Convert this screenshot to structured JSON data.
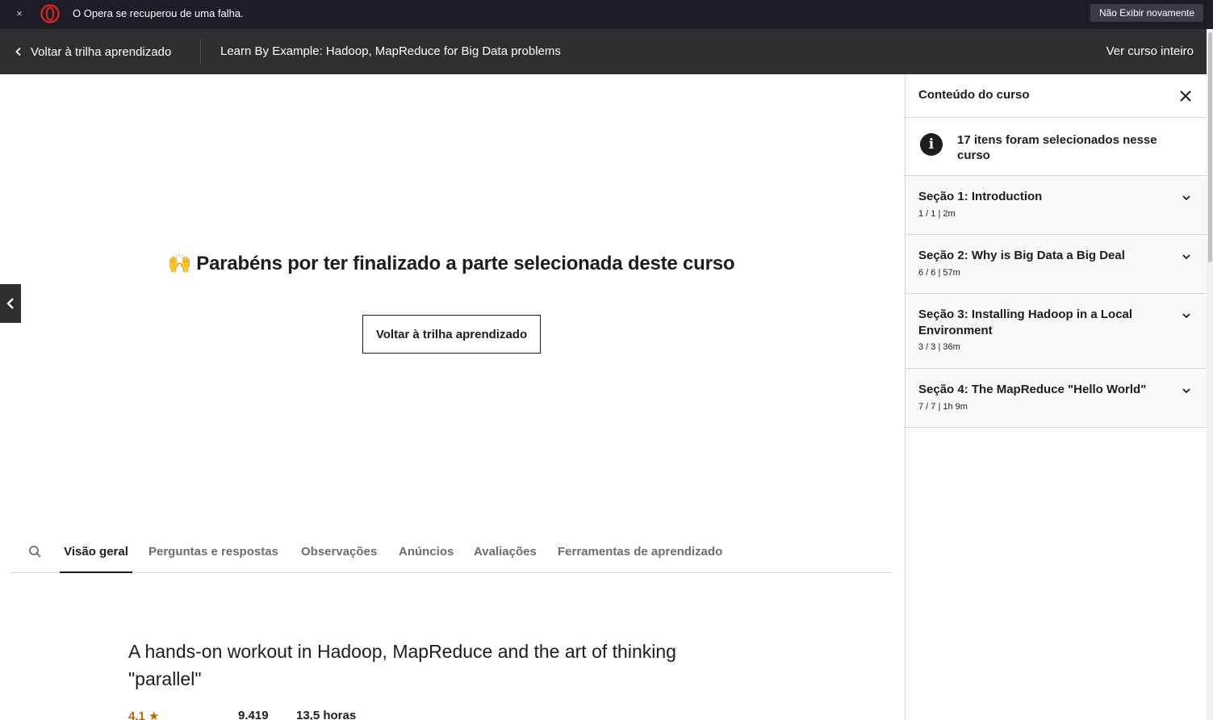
{
  "opera_bar": {
    "message": "O Opera se recuperou de uma falha.",
    "dismiss_label": "Não Exibir novamente",
    "close_glyph": "×"
  },
  "header": {
    "back_label": "Voltar à trilha aprendizado",
    "course_title": "Learn By Example: Hadoop, MapReduce for Big Data problems",
    "full_course_label": "Ver curso inteiro"
  },
  "main": {
    "congrats_emoji": "🙌",
    "congrats_text": "Parabéns por ter finalizado a parte selecionada deste curso",
    "return_button": "Voltar à trilha aprendizado"
  },
  "tabs": [
    {
      "label": "Visão geral",
      "active": true
    },
    {
      "label": "Perguntas e respostas",
      "active": false
    },
    {
      "label": "Observações",
      "active": false
    },
    {
      "label": "Anúncios",
      "active": false
    },
    {
      "label": "Avaliações",
      "active": false
    },
    {
      "label": "Ferramentas de aprendizado",
      "active": false
    }
  ],
  "overview": {
    "headline": "A hands-on workout in Hadoop, MapReduce and the art of thinking \"parallel\"",
    "rating": "4.1",
    "students": "9.419",
    "hours": "13,5 horas"
  },
  "sidebar": {
    "title": "Conteúdo do curso",
    "info_glyph": "i",
    "info_text": "17 itens foram selecionados nesse curso",
    "sections": [
      {
        "title": "Seção 1: Introduction",
        "meta": "1 / 1 | 2m"
      },
      {
        "title": "Seção 2: Why is Big Data a Big Deal",
        "meta": "6 / 6 | 57m"
      },
      {
        "title": "Seção 3: Installing Hadoop in a Local Environment",
        "meta": "3 / 3 | 36m"
      },
      {
        "title": "Seção 4: The MapReduce \"Hello World\"",
        "meta": "7 / 7 | 1h 9m"
      }
    ]
  },
  "colors": {
    "header_bg": "#2d2f31",
    "opera_bar_bg": "#1c1d25",
    "opera_red": "#e0242d",
    "rating_star": "#b4690e"
  }
}
